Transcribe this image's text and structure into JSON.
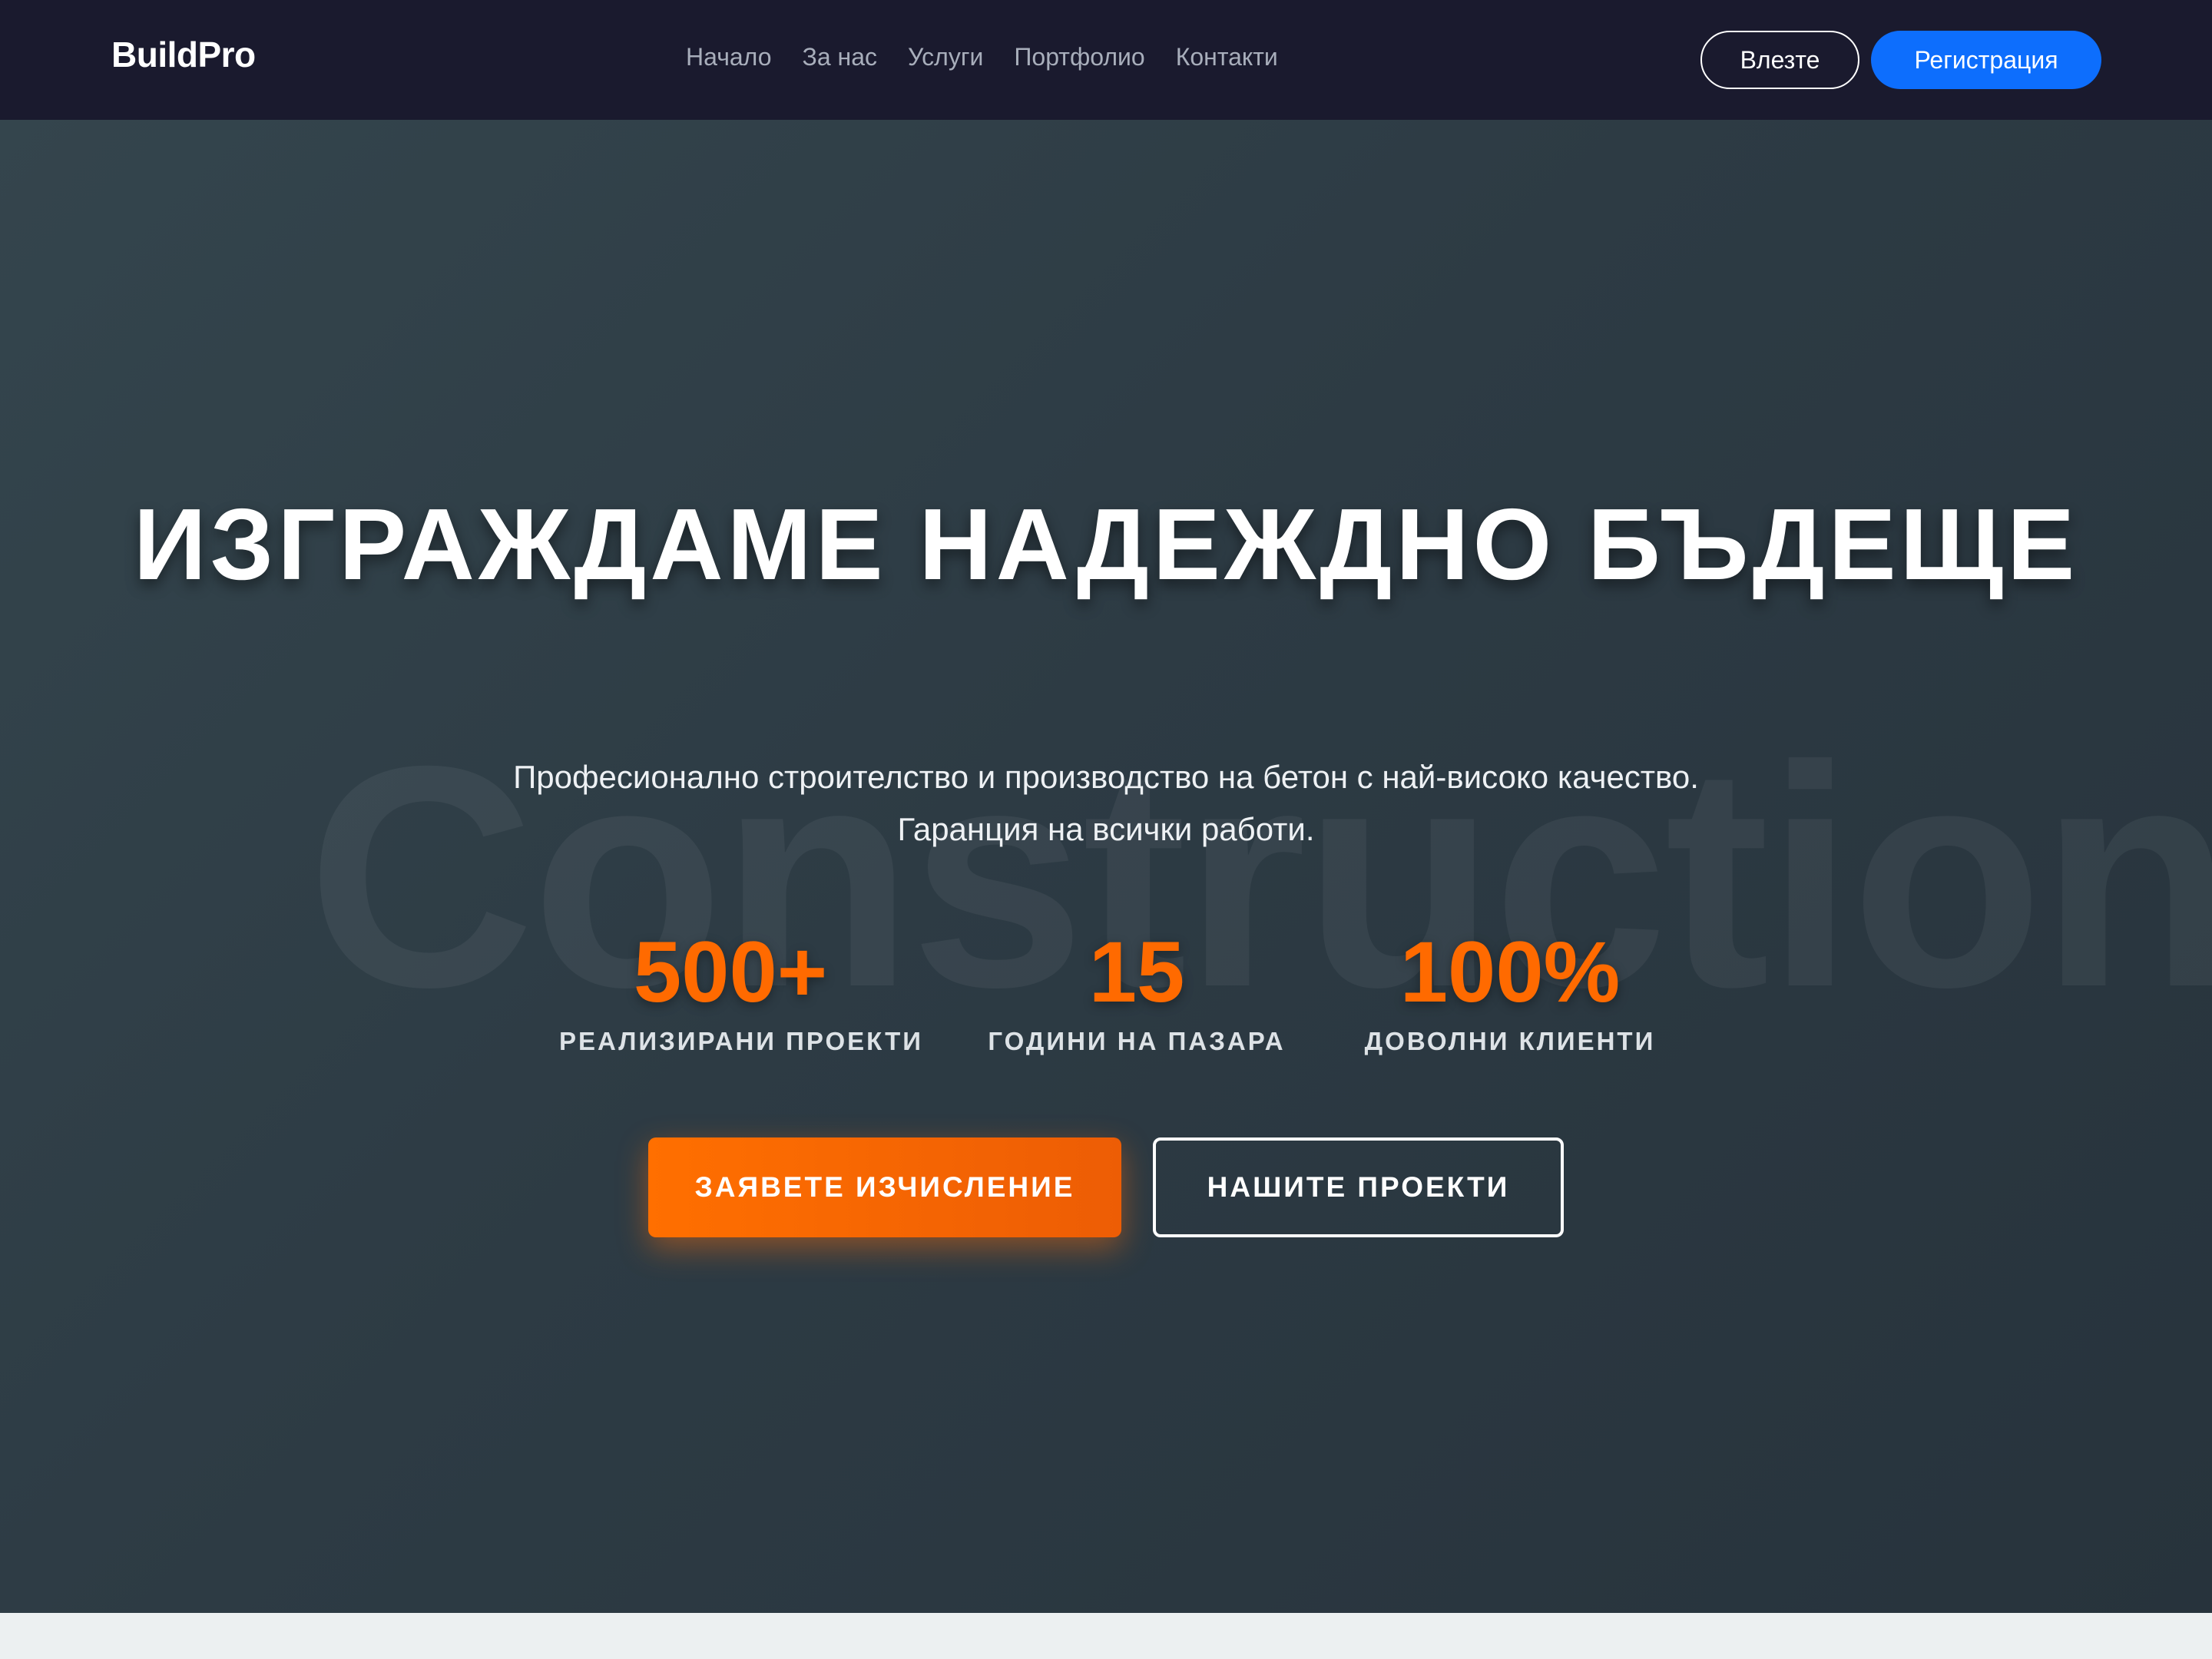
{
  "navbar": {
    "brand": "BuildPro",
    "links": [
      "Начало",
      "За нас",
      "Услуги",
      "Портфолио",
      "Контакти"
    ],
    "login_label": "Влезте",
    "register_label": "Регистрация"
  },
  "hero": {
    "watermark": "Construction",
    "title": "ИЗГРАЖДАМЕ НАДЕЖДНО БЪДЕЩЕ",
    "subtitle": "Професионално строителство и производство на бетон с най-високо качество. Гаранция на всички работи.",
    "stats": [
      {
        "value": "500+",
        "label": "РЕАЛИЗИРАНИ ПРОЕКТИ"
      },
      {
        "value": "15",
        "label": "ГОДИНИ НА ПАЗАРА"
      },
      {
        "value": "100%",
        "label": "ДОВОЛНИ КЛИЕНТИ"
      }
    ],
    "primary_cta": "ЗАЯВЕТЕ ИЗЧИСЛЕНИЕ",
    "secondary_cta": "НАШИТЕ ПРОЕКТИ"
  },
  "colors": {
    "navbar_bg": "#1a1a2e",
    "accent_orange": "#ff6a00",
    "register_blue": "#0d6efd",
    "hero_bg": "#2f3d45"
  }
}
